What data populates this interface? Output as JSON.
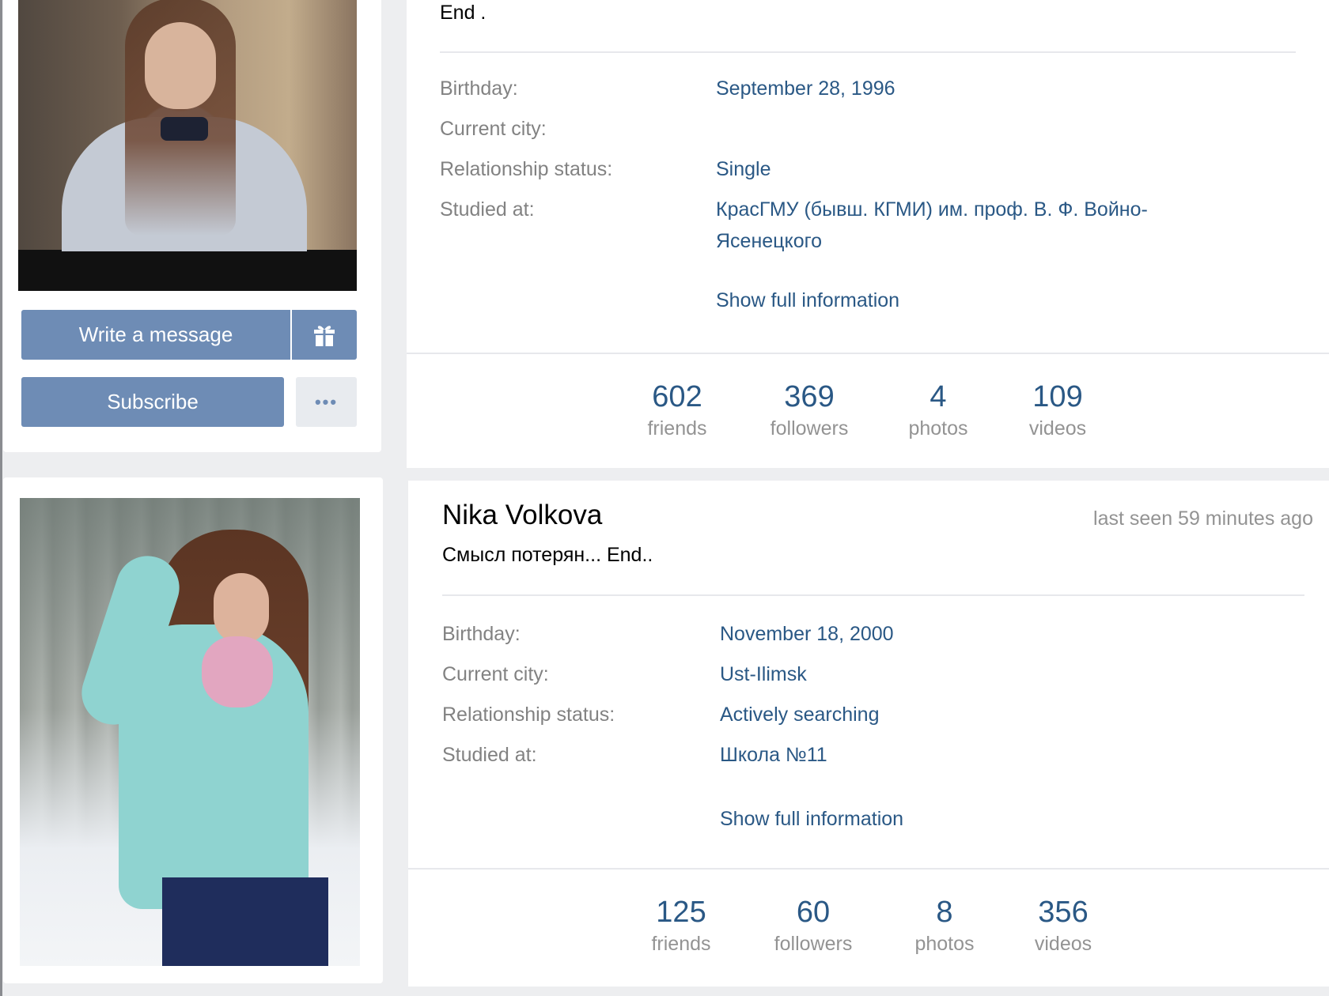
{
  "profiles": [
    {
      "name": "",
      "last_seen": "",
      "status": "End .",
      "info": [
        {
          "label": "Birthday:",
          "value": "September 28, 1996"
        },
        {
          "label": "Current city:",
          "value": ""
        },
        {
          "label": "Relationship status:",
          "value": "Single"
        },
        {
          "label": "Studied at:",
          "value": "КрасГМУ (бывш. КГМИ) им. проф. В. Ф. Войно-Ясенецкого"
        }
      ],
      "show_full": "Show full information",
      "counters": [
        {
          "num": "602",
          "label": "friends"
        },
        {
          "num": "369",
          "label": "followers"
        },
        {
          "num": "4",
          "label": "photos"
        },
        {
          "num": "109",
          "label": "videos"
        }
      ]
    },
    {
      "name": "Nika Volkova",
      "last_seen": "last seen 59 minutes ago",
      "status": "Смысл потерян... End..",
      "info": [
        {
          "label": "Birthday:",
          "value": "November 18, 2000"
        },
        {
          "label": "Current city:",
          "value": "Ust-Ilimsk"
        },
        {
          "label": "Relationship status:",
          "value": "Actively searching"
        },
        {
          "label": "Studied at:",
          "value": "Школа №11"
        }
      ],
      "show_full": "Show full information",
      "counters": [
        {
          "num": "125",
          "label": "friends"
        },
        {
          "num": "60",
          "label": "followers"
        },
        {
          "num": "8",
          "label": "photos"
        },
        {
          "num": "356",
          "label": "videos"
        }
      ]
    }
  ],
  "actions": {
    "write_message": "Write a message",
    "subscribe": "Subscribe",
    "more": "•••",
    "gift_icon": "gift-icon"
  },
  "colors": {
    "page_bg": "#edeef0",
    "button_bg": "#6e8cb5",
    "link": "#2a5885",
    "muted": "#939393"
  }
}
